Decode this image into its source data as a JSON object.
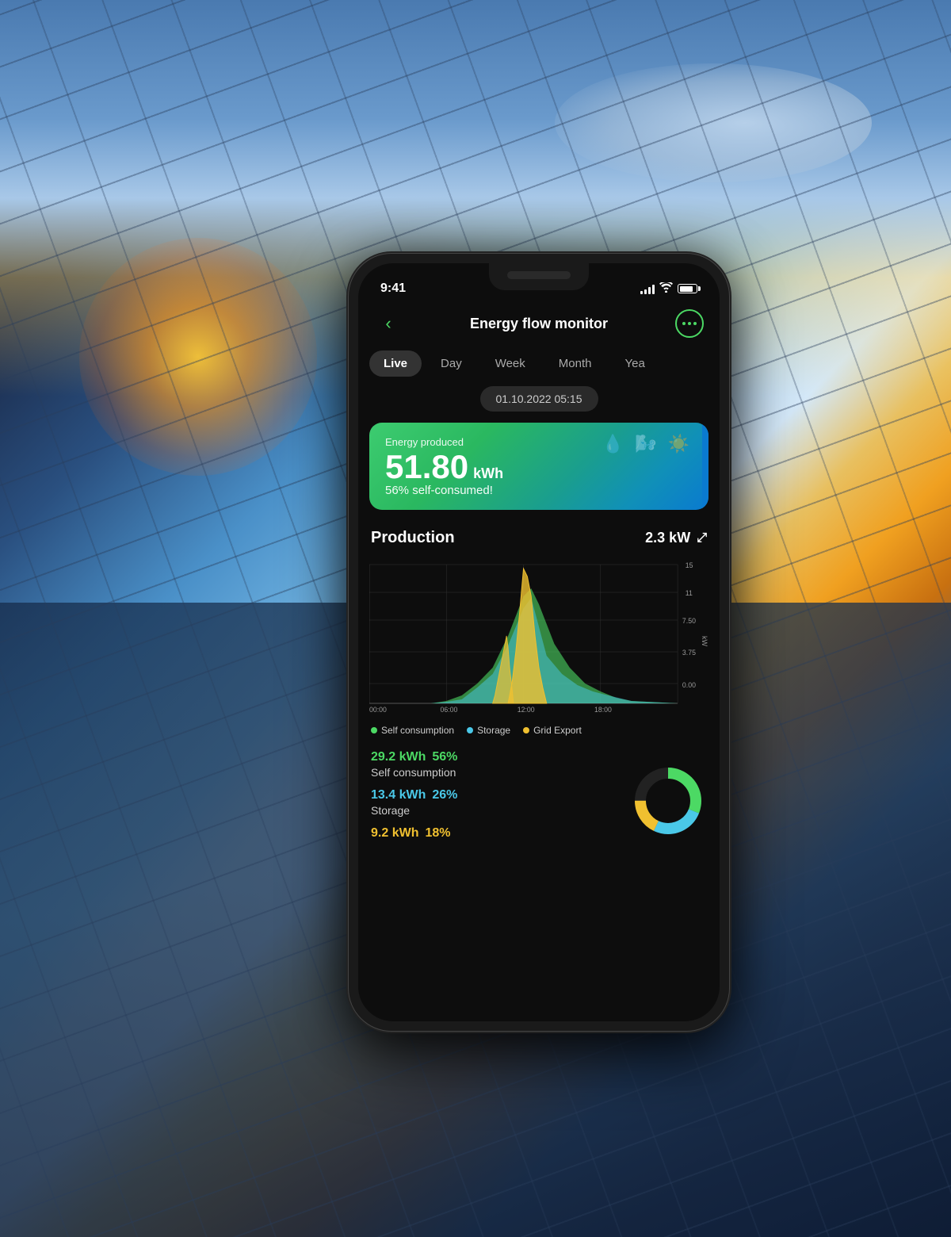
{
  "background": {
    "description": "Solar panels with sun and sky background"
  },
  "status_bar": {
    "time": "9:41",
    "signal_bars": [
      4,
      6,
      9,
      12,
      14
    ],
    "battery_pct": 80
  },
  "header": {
    "title": "Energy flow monitor",
    "back_label": "‹",
    "more_label": "···"
  },
  "tabs": [
    {
      "label": "Live",
      "active": true
    },
    {
      "label": "Day",
      "active": false
    },
    {
      "label": "Week",
      "active": false
    },
    {
      "label": "Month",
      "active": false
    },
    {
      "label": "Year",
      "active": false
    }
  ],
  "date": "01.10.2022 05:15",
  "energy_card": {
    "label": "Energy produced",
    "value": "51.80",
    "unit": "kWh",
    "sub": "56% self-consumed!"
  },
  "production_section": {
    "title": "Production",
    "value": "2.3 kW"
  },
  "chart": {
    "x_labels": [
      "00:00",
      "06:00",
      "12:00",
      "18:00"
    ],
    "y_labels": [
      "15",
      "11",
      "7.50",
      "3.75",
      "0.00"
    ],
    "y_axis_label": "kW"
  },
  "legend": [
    {
      "label": "Self consumption",
      "color": "#4cd964"
    },
    {
      "label": "Storage",
      "color": "#4ac8e8"
    },
    {
      "label": "Grid Export",
      "color": "#f0c030"
    }
  ],
  "stats": [
    {
      "kwh": "29.2 kWh",
      "pct": "56%",
      "name": "Self consumption",
      "color": "#4cd964"
    },
    {
      "kwh": "13.4 kWh",
      "pct": "26%",
      "name": "Storage",
      "color": "#4ac8e8"
    },
    {
      "kwh": "9.2 kWh",
      "pct": "18%",
      "name": "",
      "color": "#f0c030"
    }
  ]
}
